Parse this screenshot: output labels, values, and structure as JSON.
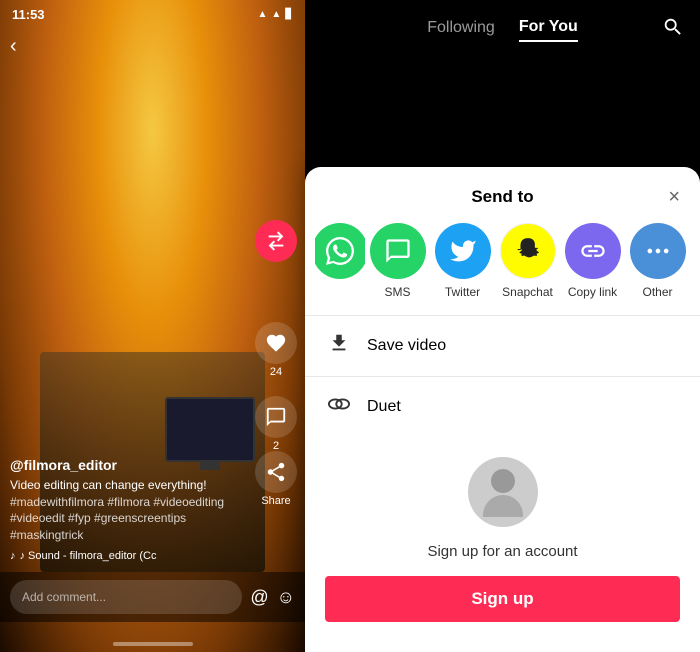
{
  "phone": {
    "time": "11:53",
    "username": "@filmora_editor",
    "caption": "Video editing can change everything!\n#madewithfilmora #filmora\n#videoediting #videoedit #fyp\n#greenscreentips #maskingtrick",
    "sound": "♪ Sound - filmora_editor (Cc",
    "comment_placeholder": "Add comment...",
    "like_count": "24",
    "comment_count": "2",
    "share_label": "Share"
  },
  "nav": {
    "following_label": "Following",
    "foryou_label": "For You",
    "search_icon": "search"
  },
  "sheet": {
    "title": "Send to",
    "close_label": "×",
    "share_items": [
      {
        "id": "partial",
        "label": "",
        "color": "#25D366"
      },
      {
        "id": "sms",
        "label": "SMS",
        "color": "#25D366"
      },
      {
        "id": "twitter",
        "label": "Twitter",
        "color": "#1DA1F2"
      },
      {
        "id": "snapchat",
        "label": "Snapchat",
        "color": "#FFFC00"
      },
      {
        "id": "copylink",
        "label": "Copy link",
        "color": "#7B68EE"
      },
      {
        "id": "other",
        "label": "Other",
        "color": "#4A90D9"
      }
    ],
    "save_video_label": "Save video",
    "duet_label": "Duet",
    "signup_prompt": "Sign up for an account",
    "signup_btn": "Sign up"
  }
}
